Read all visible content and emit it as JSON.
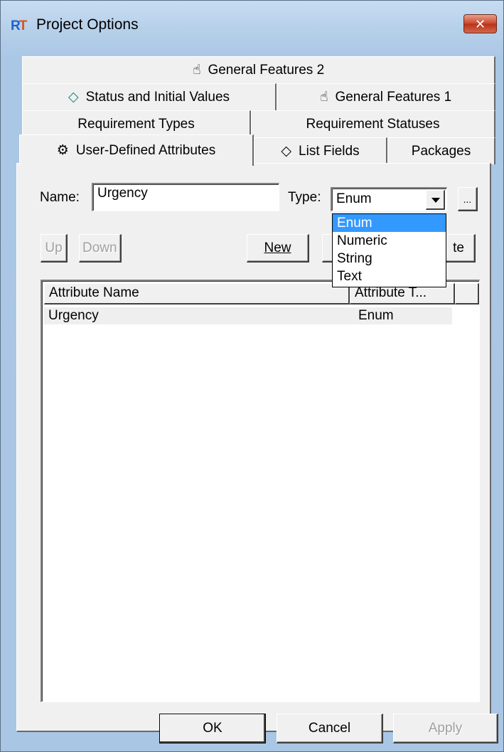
{
  "window": {
    "title": "Project Options",
    "icon": "rt-app-icon",
    "close_glyph": "✕"
  },
  "tabs": [
    {
      "label": "General Features 2",
      "icon": "hand-icon"
    },
    {
      "label": "Status and Initial Values",
      "icon": "diamond-outline-icon"
    },
    {
      "label": "General Features 1",
      "icon": "hand-icon"
    },
    {
      "label": "Requirement Types"
    },
    {
      "label": "Requirement Statuses"
    },
    {
      "label": "User-Defined Attributes",
      "icon": "gear-wand-icon",
      "active": true
    },
    {
      "label": "List Fields",
      "icon": "diamond-icon"
    },
    {
      "label": "Packages"
    }
  ],
  "form": {
    "name_label": "Name:",
    "name_value": "Urgency",
    "type_label": "Type:",
    "type_value": "Enum",
    "browse_label": "..."
  },
  "type_options": [
    "Enum",
    "Numeric",
    "String",
    "Text"
  ],
  "buttons": {
    "up": "Up",
    "down": "Down",
    "new": "New",
    "delete_partial": "te"
  },
  "table": {
    "columns": [
      "Attribute Name",
      "Attribute T..."
    ],
    "rows": [
      {
        "name": "Urgency",
        "type": "Enum"
      }
    ]
  },
  "footer": {
    "ok": "OK",
    "cancel": "Cancel",
    "apply": "Apply"
  }
}
